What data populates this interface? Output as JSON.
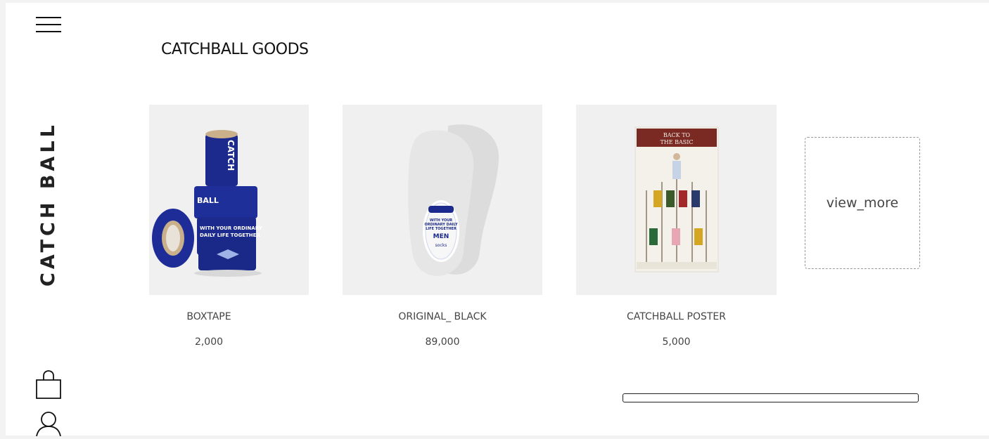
{
  "brand": {
    "name": "CATCH BALL"
  },
  "section": {
    "title": "CATCHBALL GOODS"
  },
  "products": [
    {
      "name": "BOXTAPE",
      "price": "2,000",
      "image": "blue-box-tape-rolls"
    },
    {
      "name": "ORIGINAL_ BLACK",
      "price": "89,000",
      "image": "white-no-show-socks"
    },
    {
      "name": "CATCHBALL POSTER",
      "price": "5,000",
      "image": "back-to-the-basic-poster"
    }
  ],
  "product_art": {
    "tape_text_1": "CATCH",
    "tape_text_2": "BALL",
    "tape_text_3": "WITH YOUR ORDINARY",
    "tape_text_4": "DAILY LIFE TOGETHER",
    "sock_tag_1": "WITH YOUR",
    "sock_tag_2": "ORDINARY DAILY",
    "sock_tag_3": "LIFE TOGETHER",
    "sock_tag_4": "MEN",
    "sock_tag_5": "socks",
    "poster_line_1": "BACK TO",
    "poster_line_2": "THE BASIC"
  },
  "view_more": {
    "label": "view_more"
  },
  "icons": {
    "menu": "hamburger-menu-icon",
    "bag": "shopping-bag-icon",
    "user": "user-icon"
  },
  "colors": {
    "tape_blue": "#1b2a8c",
    "poster_red": "#7a2a22",
    "background": "#ffffff"
  }
}
